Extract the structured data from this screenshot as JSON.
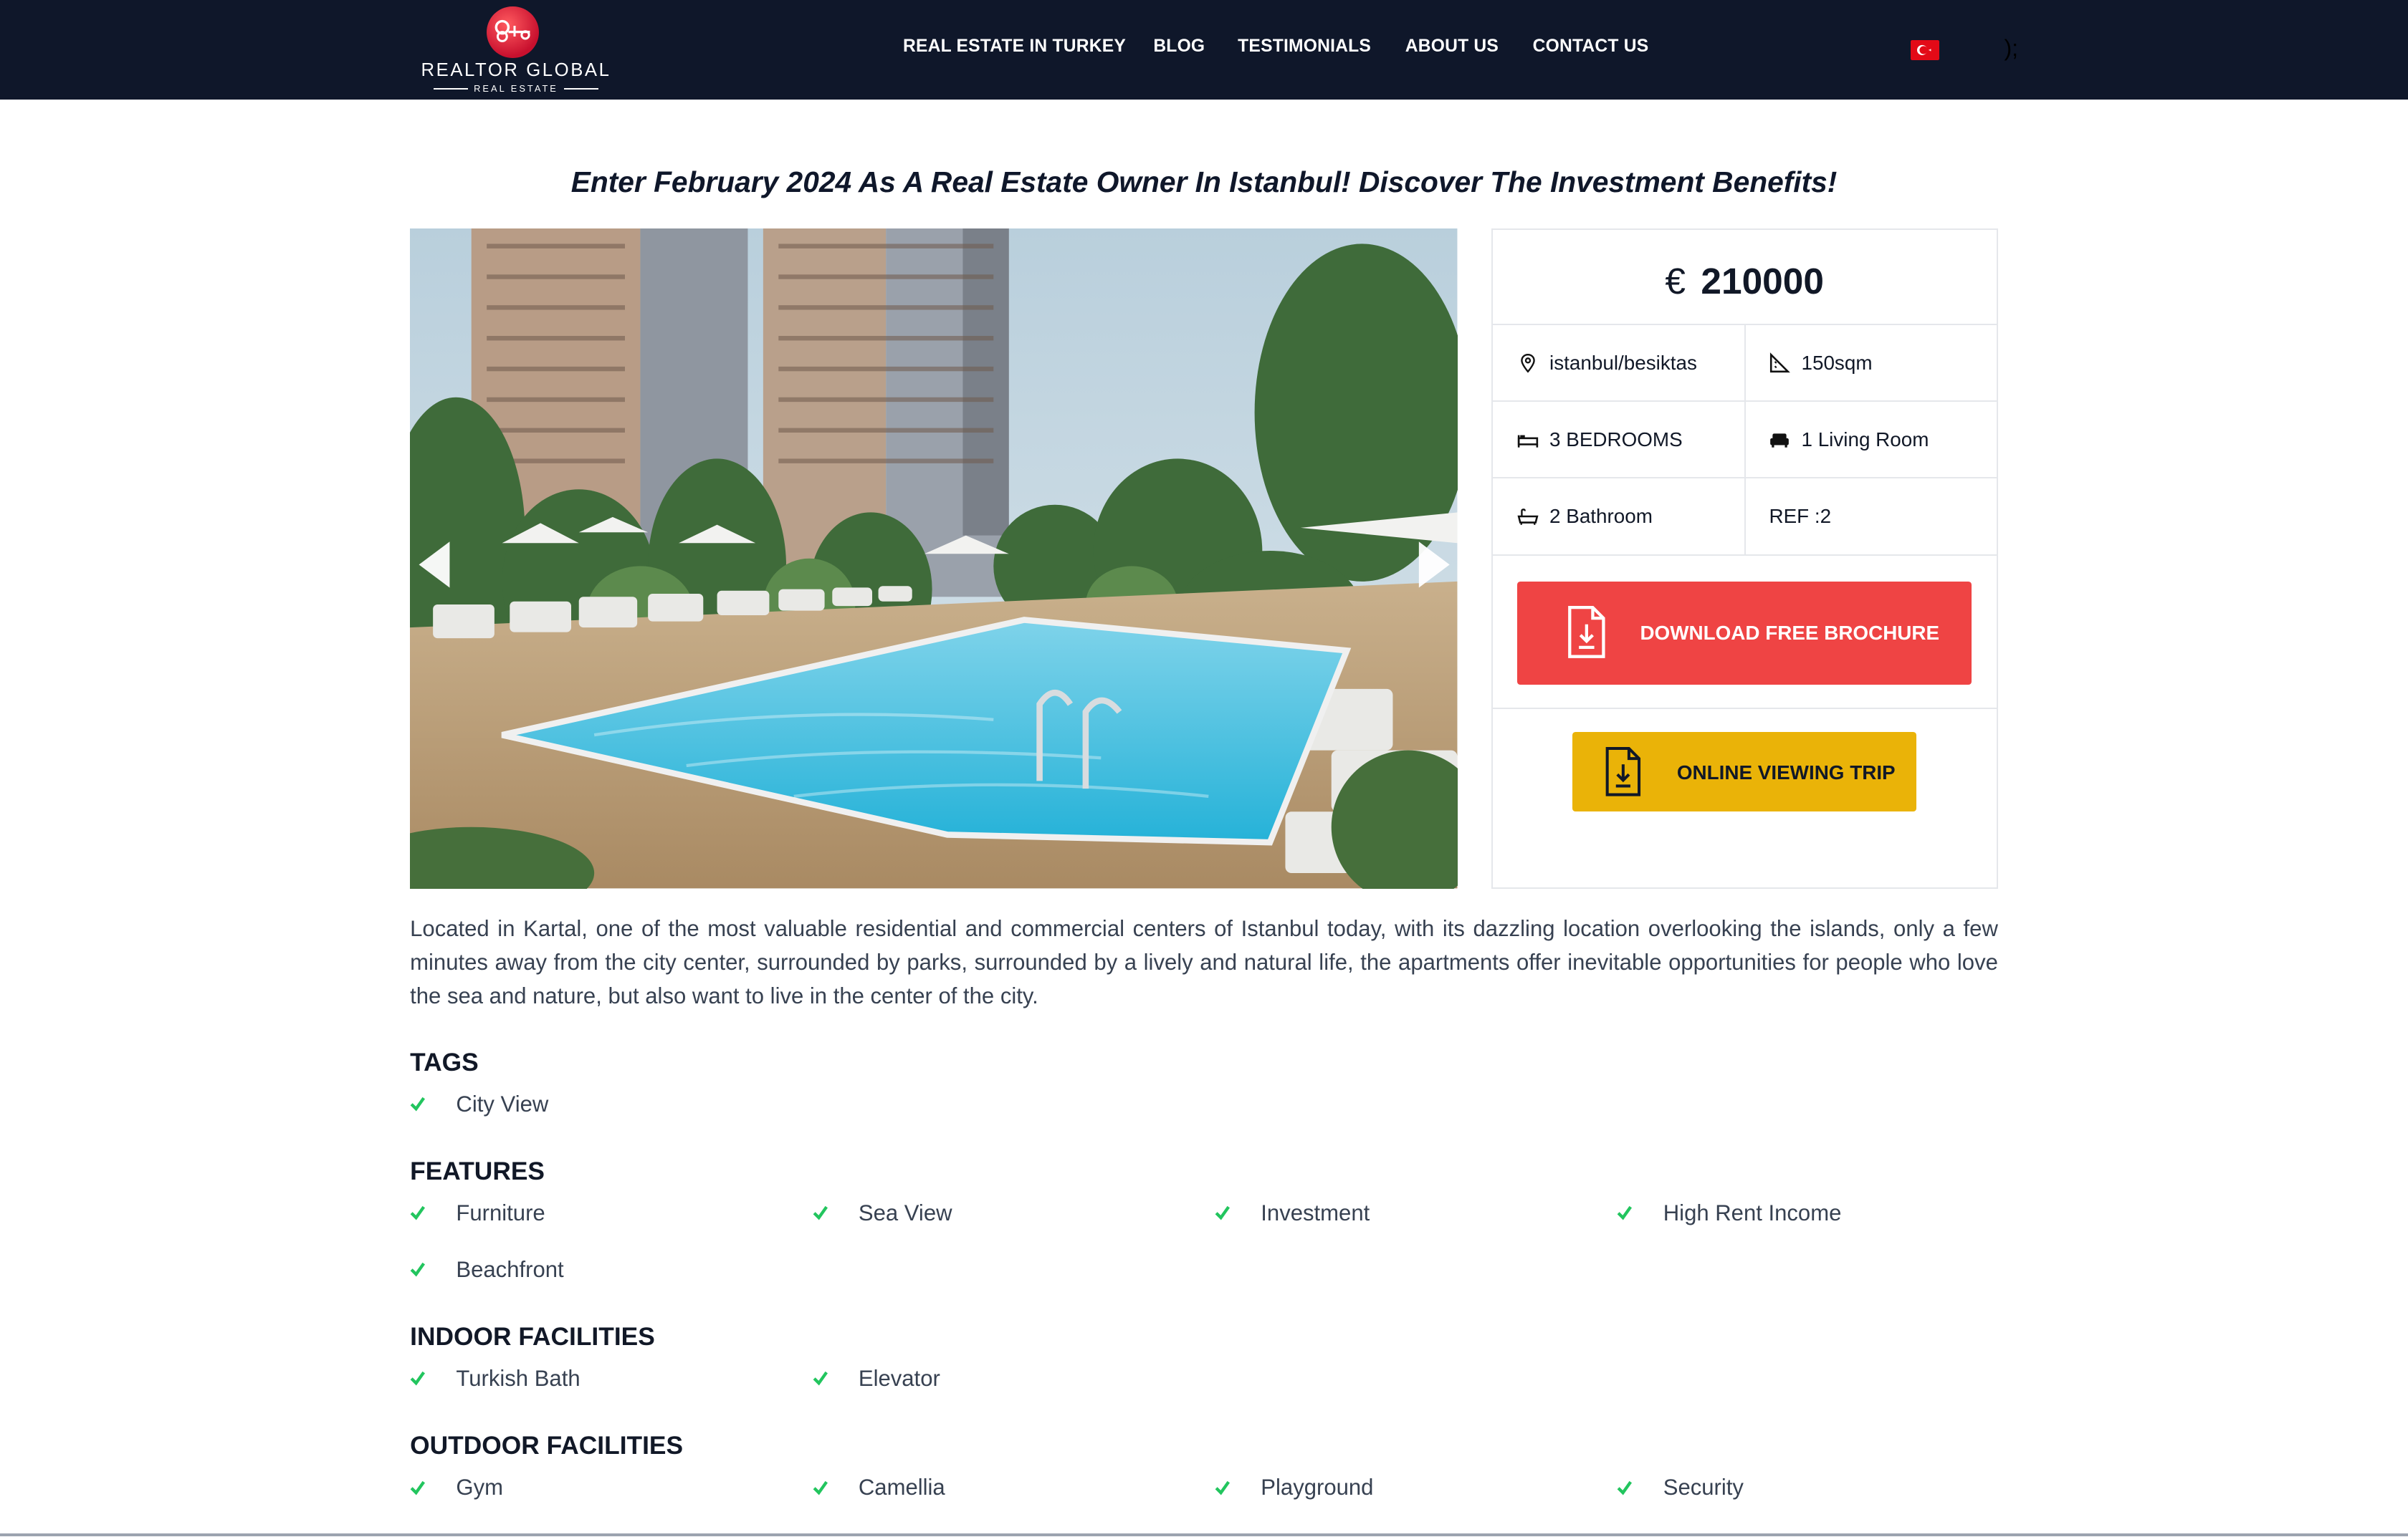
{
  "header": {
    "logo_title": "REALTOR GLOBAL",
    "logo_subtitle": "REAL ESTATE",
    "nav": [
      {
        "label": "REAL ESTATE IN TURKEY"
      },
      {
        "label": "BLOG"
      },
      {
        "label": "TESTIMONIALS"
      },
      {
        "label": "ABOUT US"
      },
      {
        "label": "CONTACT US"
      }
    ],
    "language_flag": "turkey-flag-icon",
    "stray_text": ");"
  },
  "page_title": "Enter February 2024 As A Real Estate Owner In Istanbul! Discover The Investment Benefits!",
  "gallery": {
    "prev_icon": "chevron-left-icon",
    "next_icon": "chevron-right-icon"
  },
  "listing": {
    "currency": "€",
    "price": "210000",
    "location": "istanbul/besiktas",
    "area": "150sqm",
    "bedrooms": "3 BEDROOMS",
    "living_rooms": "1 Living Room",
    "bathrooms": "2 Bathroom",
    "ref": "REF :2",
    "brochure_button": "DOWNLOAD FREE BROCHURE",
    "viewing_button": "ONLINE VIEWING TRIP"
  },
  "description": "Located in Kartal, one of the most valuable residential and commercial centers of Istanbul today, with its dazzling location overlooking the islands, only a few minutes away from the city center, surrounded by parks, surrounded by a lively and natural life, the apartments offer inevitable opportunities for people who love the sea and nature, but also want to live in the center of the city.",
  "sections": {
    "tags": {
      "title": "TAGS",
      "items": [
        "City View"
      ]
    },
    "features": {
      "title": "FEATURES",
      "items": [
        "Furniture",
        "Sea View",
        "Investment",
        "High Rent Income",
        "Beachfront"
      ]
    },
    "indoor": {
      "title": "INDOOR FACILITIES",
      "items": [
        "Turkish Bath",
        "Elevator"
      ]
    },
    "outdoor": {
      "title": "OUTDOOR FACILITIES",
      "items": [
        "Gym",
        "Camellia",
        "Playground",
        "Security"
      ]
    }
  },
  "colors": {
    "header_bg": "#0f172a",
    "brochure_button": "#ef4444",
    "viewing_button": "#eab308",
    "check": "#22c55e"
  }
}
